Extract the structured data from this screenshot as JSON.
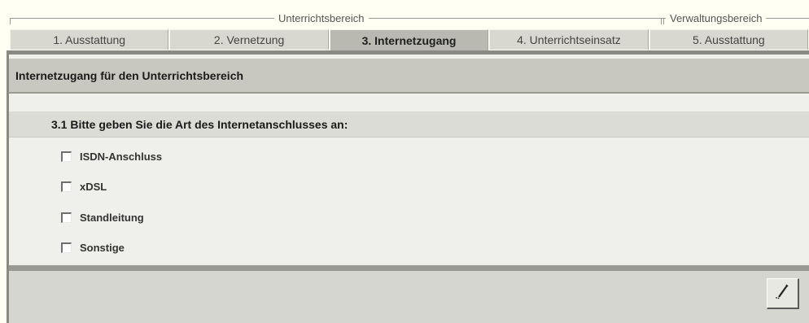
{
  "groups": {
    "unterricht_label": "Unterrichtsbereich",
    "verwaltung_label": "Verwaltungsbereich"
  },
  "tabs": [
    {
      "label": "1. Ausstattung",
      "active": false
    },
    {
      "label": "2. Vernetzung",
      "active": false
    },
    {
      "label": "3. Internetzugang",
      "active": true
    },
    {
      "label": "4. Unterrichtseinsatz",
      "active": false
    },
    {
      "label": "5. Ausstattung",
      "active": false
    }
  ],
  "panel": {
    "header": "Internetzugang für den Unterrichtsbereich",
    "question": "3.1 Bitte geben Sie die Art des Internetanschlusses an:",
    "options": [
      {
        "label": "ISDN-Anschluss",
        "checked": false
      },
      {
        "label": "xDSL",
        "checked": false
      },
      {
        "label": "Standleitung",
        "checked": false
      },
      {
        "label": "Sonstige",
        "checked": false
      }
    ]
  },
  "icons": {
    "edit": "pencil-icon"
  }
}
